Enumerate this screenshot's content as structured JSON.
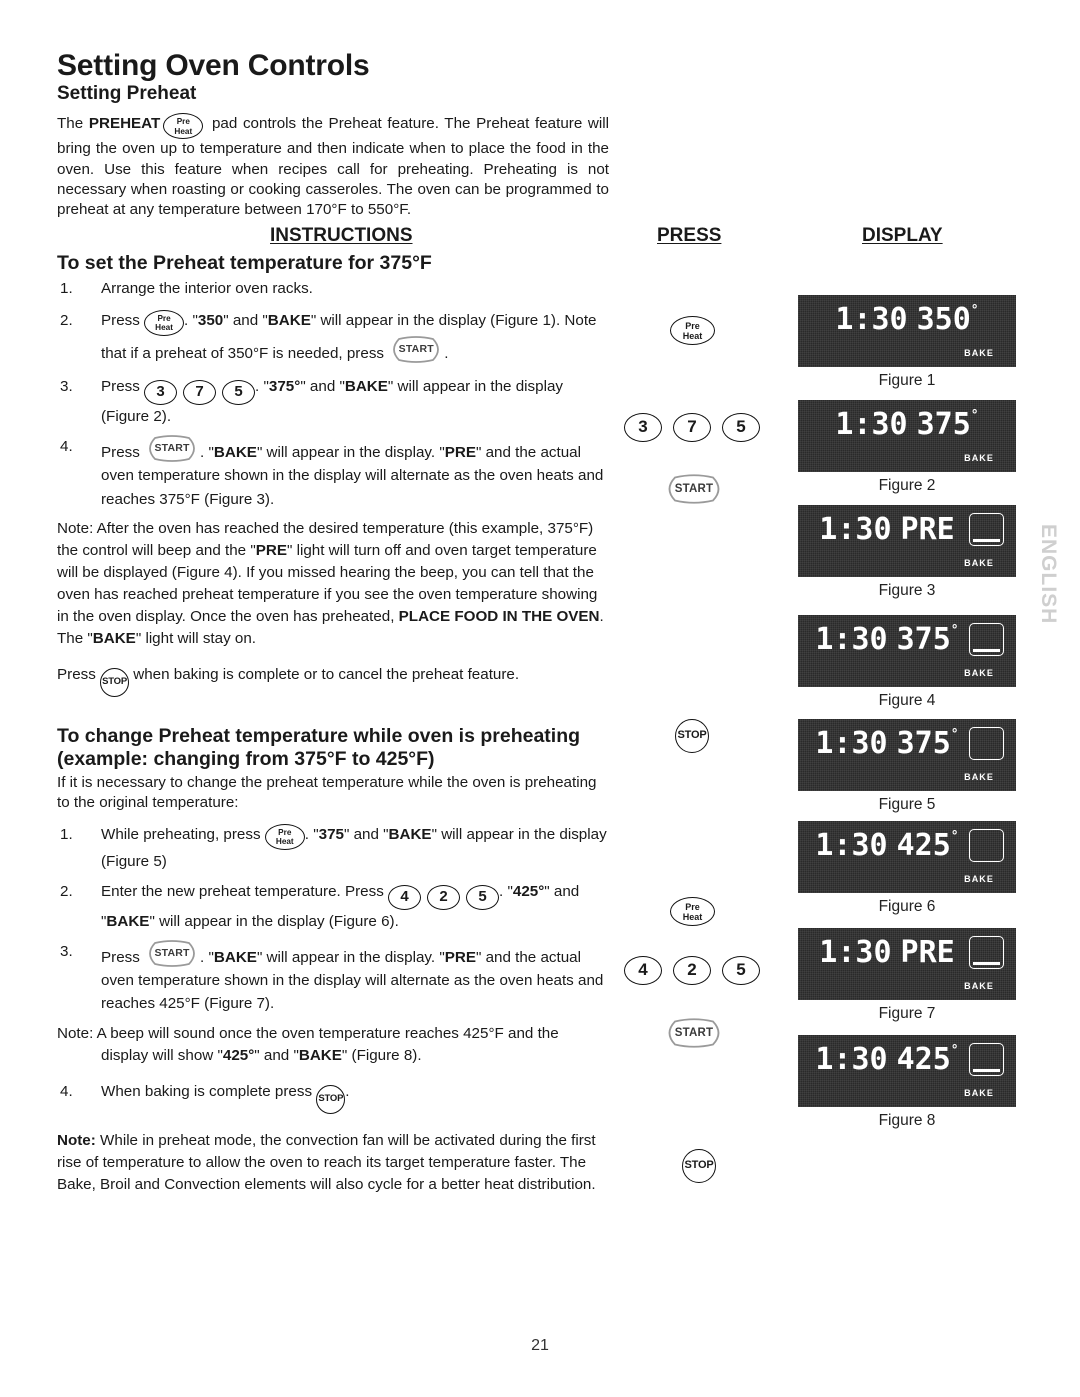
{
  "document": {
    "title": "Setting Oven Controls",
    "subtitle": "Setting Preheat",
    "page_number": "21",
    "side_tab": "ENGLISH"
  },
  "intro": {
    "part1": "The ",
    "preheat_bold": "PREHEAT",
    "part2": " pad controls the Preheat feature. The Preheat feature will bring the oven up to temperature and then indicate when to place the food in the oven. Use this feature when recipes call for preheating. Preheating is not necessary when roasting or cooking casseroles. The oven can be programmed to preheat at any temperature between 170°F to 550°F."
  },
  "column_headers": {
    "instructions": "INSTRUCTIONS",
    "press": "PRESS",
    "display": "DISPLAY"
  },
  "keys": {
    "preheat_line1": "Pre",
    "preheat_line2": "Heat",
    "start": "START",
    "stop": "STOP",
    "digit_3": "3",
    "digit_7": "7",
    "digit_5": "5",
    "digit_4": "4",
    "digit_2": "2",
    "digit_5b": "5"
  },
  "section1": {
    "heading": "To set the Preheat temperature for 375°F",
    "steps": [
      {
        "num": "1.",
        "text_a": "Arrange the interior oven racks."
      },
      {
        "num": "2.",
        "text_a": "Press ",
        "text_b": ". \"",
        "bold1": "350",
        "text_c": "\" and \"",
        "bold2": "BAKE",
        "text_d": "\" will appear in the display (Figure 1). Note that if a preheat of 350°F is needed, press ",
        "text_e": "."
      },
      {
        "num": "3.",
        "text_a": "Press ",
        "text_b": ". \"",
        "bold1": "375°",
        "text_c": "\" and \"",
        "bold2": "BAKE",
        "text_d": "\" will appear in the display (Figure 2)."
      },
      {
        "num": "4.",
        "text_a": "Press ",
        "text_b": ". \"",
        "bold1": "BAKE",
        "text_c": "\" will appear in the display. \"",
        "bold2": "PRE",
        "text_d": "\" and the actual oven temperature shown in the display will alternate as the oven heats and reaches 375°F (Figure 3)."
      }
    ],
    "note_a": "Note: After the oven has reached the desired temperature (this example, 375°F) the control will beep and the \"",
    "note_bold1": "PRE",
    "note_b": "\" light will turn off and oven target temperature will be displayed (Figure 4). If you missed hearing the beep, you can tell that the oven has reached preheat temperature if you see the oven temperature showing in the oven display. Once the oven has preheated, ",
    "note_bold2": "PLACE FOOD IN THE OVEN",
    "note_c": ". The \"",
    "note_bold3": "BAKE",
    "note_d": "\" light will stay on.",
    "stop_line_a": "Press ",
    "stop_line_b": " when baking is complete or to cancel the preheat feature."
  },
  "section2": {
    "heading": "To change Preheat temperature while oven is preheating (example: changing from 375°F to 425°F)",
    "intro": "If it is necessary to change the preheat temperature while the oven is preheating to the original temperature:",
    "steps": [
      {
        "num": "1.",
        "text_a": "While preheating, press ",
        "text_b": ". \"",
        "bold1": "375",
        "text_c": "\" and \"",
        "bold2": "BAKE",
        "text_d": "\" will appear in the display (Figure 5)"
      },
      {
        "num": "2.",
        "text_a": "Enter the new preheat temperature. Press ",
        "text_b": ". \"",
        "bold1": "425°",
        "text_c": "\" and \"",
        "bold2": "BAKE",
        "text_d": "\"  will appear in the display (Figure 6)."
      },
      {
        "num": "3.",
        "text_a": "Press ",
        "text_b": ". \"",
        "bold1": "BAKE",
        "text_c": "\" will appear in the display. \"",
        "bold2": "PRE",
        "text_d": "\" and the actual oven temperature shown in the display will alternate as the oven heats and reaches 425°F (Figure 7)."
      }
    ],
    "note_a": "Note: A beep will sound once the oven temperature reaches 425°F and  the display will show \"",
    "note_bold1": "425°",
    "note_b": "\" and \"",
    "note_bold2": "BAKE",
    "note_c": "\" (Figure 8).",
    "step4": {
      "num": "4.",
      "text_a": "When baking is complete press ",
      "text_b": "."
    },
    "final_note_bold": "Note:",
    "final_note": "  While in preheat mode, the convection fan will be activated during the first rise of temperature to allow the oven to reach its target temperature faster. The Bake, Broil and Convection elements will also cycle for a better heat distribution."
  },
  "figures": [
    {
      "caption": "Figure 1",
      "time": "1:30",
      "value": "350",
      "degree": "°",
      "bake": "BAKE",
      "oven_box": false,
      "oven_lit": false
    },
    {
      "caption": "Figure 2",
      "time": "1:30",
      "value": "375",
      "degree": "°",
      "bake": "BAKE",
      "oven_box": false,
      "oven_lit": false
    },
    {
      "caption": "Figure 3",
      "time": "1:30",
      "value": "PRE",
      "degree": "",
      "bake": "BAKE",
      "oven_box": true,
      "oven_lit": true
    },
    {
      "caption": "Figure 4",
      "time": "1:30",
      "value": "375",
      "degree": "°",
      "bake": "BAKE",
      "oven_box": true,
      "oven_lit": true
    },
    {
      "caption": "Figure 5",
      "time": "1:30",
      "value": "375",
      "degree": "°",
      "bake": "BAKE",
      "oven_box": true,
      "oven_lit": false
    },
    {
      "caption": "Figure 6",
      "time": "1:30",
      "value": "425",
      "degree": "°",
      "bake": "BAKE",
      "oven_box": true,
      "oven_lit": false
    },
    {
      "caption": "Figure 7",
      "time": "1:30",
      "value": "PRE",
      "degree": "",
      "bake": "BAKE",
      "oven_box": true,
      "oven_lit": true
    },
    {
      "caption": "Figure 8",
      "time": "1:30",
      "value": "425",
      "degree": "°",
      "bake": "BAKE",
      "oven_box": true,
      "oven_lit": true
    }
  ],
  "colors": {
    "lcd_background": "#2a2a2a",
    "lcd_text": "#ffffff",
    "ink": "#1a1a1a",
    "side_tab": "#cfcfcf",
    "start_key_outline": "#9a9a9a"
  }
}
